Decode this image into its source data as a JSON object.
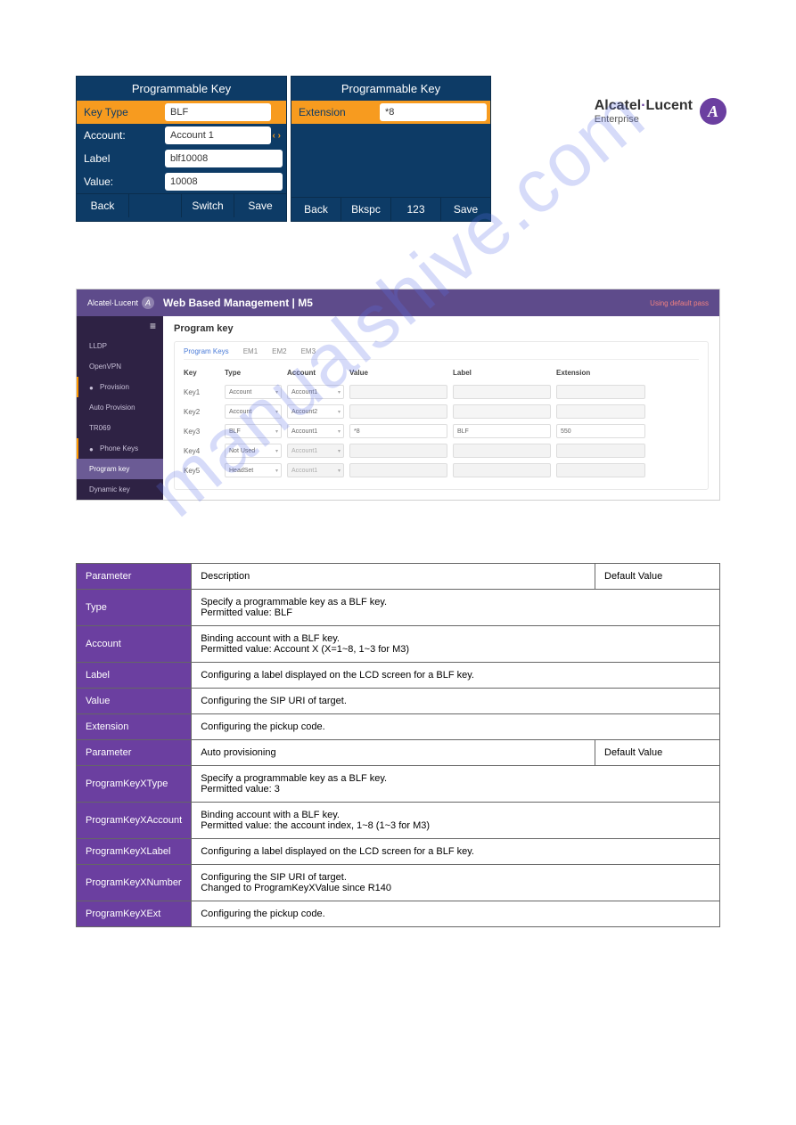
{
  "logo": {
    "brand_a": "Alcatel",
    "brand_b": "Lucent",
    "sub": "Enterprise",
    "glyph": "A"
  },
  "phone": {
    "left": {
      "title": "Programmable Key",
      "fields": [
        {
          "label": "Key Type",
          "value": "BLF",
          "highlight": true,
          "arrows": "‹ ›"
        },
        {
          "label": "Account:",
          "value": "Account 1",
          "highlight": false,
          "arrows": "‹ ›"
        },
        {
          "label": "Label",
          "value": "blf10008",
          "highlight": false,
          "arrows": ""
        },
        {
          "label": "Value:",
          "value": "10008",
          "highlight": false,
          "arrows": ""
        }
      ],
      "softkeys": [
        "Back",
        "",
        "Switch",
        "Save"
      ]
    },
    "right": {
      "title": "Programmable Key",
      "fields": [
        {
          "label": "Extension",
          "value": "*8",
          "highlight": true,
          "arrows": ""
        }
      ],
      "softkeys": [
        "Back",
        "Bkspc",
        "123",
        "Save"
      ]
    }
  },
  "web": {
    "logo_text": "Alcatel·Lucent",
    "title": "Web Based Management | M5",
    "warning": "Using default pass",
    "sidebar": [
      {
        "label": "LLDP",
        "accent": false,
        "icon": ""
      },
      {
        "label": "OpenVPN",
        "accent": false,
        "icon": ""
      },
      {
        "label": "Provision",
        "accent": true,
        "icon": "●"
      },
      {
        "label": "Auto Provision",
        "accent": false,
        "icon": ""
      },
      {
        "label": "TR069",
        "accent": false,
        "icon": ""
      },
      {
        "label": "Phone Keys",
        "accent": true,
        "icon": "●"
      },
      {
        "label": "Program key",
        "accent": false,
        "active": true,
        "icon": ""
      },
      {
        "label": "Dynamic key",
        "accent": false,
        "icon": ""
      }
    ],
    "page_title": "Program key",
    "tabs": [
      "Program Keys",
      "EM1",
      "EM2",
      "EM3"
    ],
    "columns": [
      "Key",
      "Type",
      "Account",
      "Value",
      "Label",
      "Extension"
    ],
    "rows": [
      {
        "key": "Key1",
        "type": "Account",
        "account": "Account1",
        "value": "",
        "label": "",
        "ext": "",
        "disabled": false
      },
      {
        "key": "Key2",
        "type": "Account",
        "account": "Account2",
        "value": "",
        "label": "",
        "ext": "",
        "disabled": false
      },
      {
        "key": "Key3",
        "type": "BLF",
        "account": "Account1",
        "value": "*8",
        "label": "BLF",
        "ext": "550",
        "disabled": false
      },
      {
        "key": "Key4",
        "type": "Not Used",
        "account": "Account1",
        "value": "",
        "label": "",
        "ext": "",
        "disabled": true
      },
      {
        "key": "Key5",
        "type": "HeadSet",
        "account": "Account1",
        "value": "",
        "label": "",
        "ext": "",
        "disabled": true
      }
    ]
  },
  "params": [
    {
      "name": "Parameter",
      "desc": "Description",
      "default": "Default Value"
    },
    {
      "name": "Type",
      "desc": "Specify a programmable key as a BLF key.\nPermitted value: BLF",
      "default": ""
    },
    {
      "name": "Account",
      "desc": "Binding account with a BLF key.\nPermitted value: Account X (X=1~8, 1~3 for M3)",
      "default": ""
    },
    {
      "name": "Label",
      "desc": "Configuring a label displayed on the LCD screen for a BLF key.",
      "default": ""
    },
    {
      "name": "Value",
      "desc": "Configuring the SIP URI of target.",
      "default": ""
    },
    {
      "name": "Extension",
      "desc": "Configuring the pickup code.",
      "default": ""
    },
    {
      "name": "Parameter",
      "desc": "Auto provisioning",
      "default": "Default Value"
    },
    {
      "name": "ProgramKeyXType",
      "desc": "Specify a programmable key as a BLF key.\nPermitted value: 3",
      "default": ""
    },
    {
      "name": "ProgramKeyXAccount",
      "desc": "Binding account with a BLF key.\nPermitted value: the account index, 1~8 (1~3 for M3)",
      "default": ""
    },
    {
      "name": "ProgramKeyXLabel",
      "desc": "Configuring a label displayed on the LCD screen for a BLF key.",
      "default": ""
    },
    {
      "name": "ProgramKeyXNumber",
      "desc": "Configuring the SIP URI of target.\nChanged to ProgramKeyXValue since R140",
      "default": ""
    },
    {
      "name": "ProgramKeyXExt",
      "desc": "Configuring the pickup code.",
      "default": ""
    }
  ],
  "watermark": "manualshive.com"
}
